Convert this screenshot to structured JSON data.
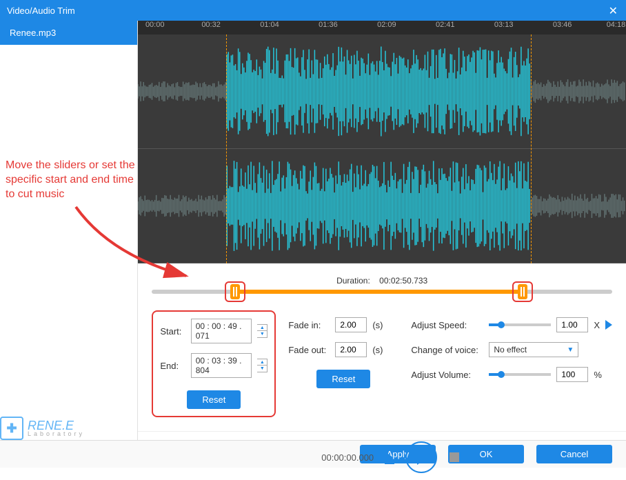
{
  "window": {
    "title": "Video/Audio Trim"
  },
  "sidebar": {
    "file": "Renee.mp3"
  },
  "timeline": {
    "ticks": [
      "00:00",
      "00:32",
      "01:04",
      "01:36",
      "02:09",
      "02:41",
      "03:13",
      "03:46",
      "04:18"
    ],
    "tickPositions": [
      1.5,
      13,
      25,
      37,
      49,
      61,
      73,
      85,
      96
    ]
  },
  "duration": {
    "label": "Duration:",
    "value": "00:02:50.733"
  },
  "trim": {
    "startLabel": "Start:",
    "startValue": "00 : 00 : 49 . 071",
    "endLabel": "End:",
    "endValue": "00 : 03 : 39 . 804",
    "reset": "Reset"
  },
  "fade": {
    "inLabel": "Fade in:",
    "inValue": "2.00",
    "outLabel": "Fade out:",
    "outValue": "2.00",
    "unit": "(s)",
    "reset": "Reset"
  },
  "speed": {
    "label": "Adjust Speed:",
    "value": "1.00",
    "suffix": "X"
  },
  "voice": {
    "label": "Change of voice:",
    "value": "No effect"
  },
  "volume": {
    "label": "Adjust Volume:",
    "value": "100",
    "suffix": "%"
  },
  "playback": {
    "time": "00:00:00.000"
  },
  "footer": {
    "apply": "Apply",
    "ok": "OK",
    "cancel": "Cancel"
  },
  "annotation": {
    "text": "Move the sliders or set the specific start and end time to cut music"
  },
  "logo": {
    "brand": "RENE.E",
    "sub": "Laboratory"
  }
}
